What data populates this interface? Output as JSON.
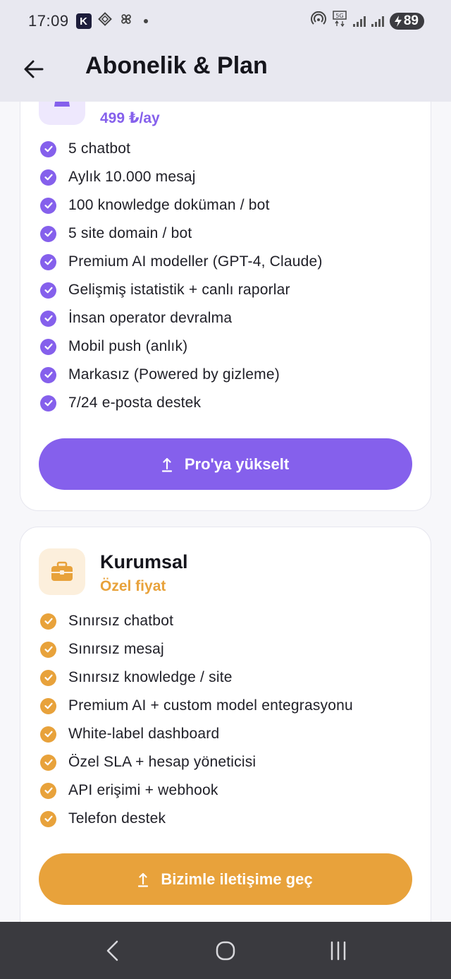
{
  "status_bar": {
    "time": "17:09",
    "notif_badge": "K",
    "battery": "89"
  },
  "header": {
    "title": "Abonelik & Plan"
  },
  "colors": {
    "purple": "#8560ec",
    "purple_light": "#eee8fd",
    "orange": "#e8a23b",
    "orange_light": "#fcefdc"
  },
  "pro_plan": {
    "icon": "crown-icon",
    "price": "499 ₺/ay",
    "features": [
      "5 chatbot",
      "Aylık 10.000 mesaj",
      "100 knowledge doküman / bot",
      "5 site domain / bot",
      "Premium AI modeller (GPT-4, Claude)",
      "Gelişmiş istatistik + canlı raporlar",
      "İnsan operator devralma",
      "Mobil push (anlık)",
      "Markasız (Powered by gizleme)",
      "7/24 e-posta destek"
    ],
    "cta_label": "Pro'ya yükselt"
  },
  "enterprise_plan": {
    "icon": "briefcase-icon",
    "name": "Kurumsal",
    "price": "Özel fiyat",
    "features": [
      "Sınırsız chatbot",
      "Sınırsız mesaj",
      "Sınırsız knowledge / site",
      "Premium AI + custom model entegrasyonu",
      "White-label dashboard",
      "Özel SLA + hesap yöneticisi",
      "API erişimi + webhook",
      "Telefon destek"
    ],
    "cta_label": "Bizimle iletişime geç"
  }
}
